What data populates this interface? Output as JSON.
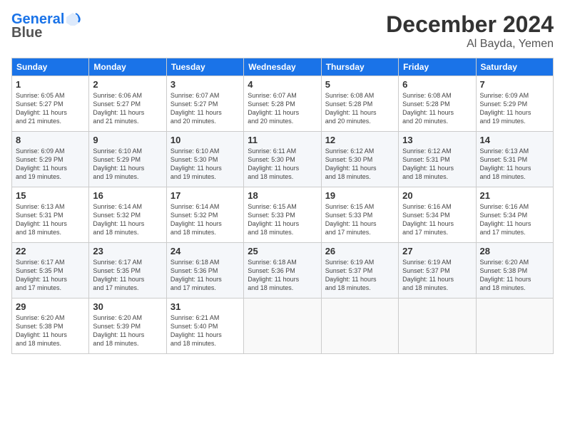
{
  "header": {
    "logo_line1": "General",
    "logo_line2": "Blue",
    "month": "December 2024",
    "location": "Al Bayda, Yemen"
  },
  "days_of_week": [
    "Sunday",
    "Monday",
    "Tuesday",
    "Wednesday",
    "Thursday",
    "Friday",
    "Saturday"
  ],
  "weeks": [
    [
      {
        "day": "1",
        "info": "Sunrise: 6:05 AM\nSunset: 5:27 PM\nDaylight: 11 hours\nand 21 minutes."
      },
      {
        "day": "2",
        "info": "Sunrise: 6:06 AM\nSunset: 5:27 PM\nDaylight: 11 hours\nand 21 minutes."
      },
      {
        "day": "3",
        "info": "Sunrise: 6:07 AM\nSunset: 5:27 PM\nDaylight: 11 hours\nand 20 minutes."
      },
      {
        "day": "4",
        "info": "Sunrise: 6:07 AM\nSunset: 5:28 PM\nDaylight: 11 hours\nand 20 minutes."
      },
      {
        "day": "5",
        "info": "Sunrise: 6:08 AM\nSunset: 5:28 PM\nDaylight: 11 hours\nand 20 minutes."
      },
      {
        "day": "6",
        "info": "Sunrise: 6:08 AM\nSunset: 5:28 PM\nDaylight: 11 hours\nand 20 minutes."
      },
      {
        "day": "7",
        "info": "Sunrise: 6:09 AM\nSunset: 5:29 PM\nDaylight: 11 hours\nand 19 minutes."
      }
    ],
    [
      {
        "day": "8",
        "info": "Sunrise: 6:09 AM\nSunset: 5:29 PM\nDaylight: 11 hours\nand 19 minutes."
      },
      {
        "day": "9",
        "info": "Sunrise: 6:10 AM\nSunset: 5:29 PM\nDaylight: 11 hours\nand 19 minutes."
      },
      {
        "day": "10",
        "info": "Sunrise: 6:10 AM\nSunset: 5:30 PM\nDaylight: 11 hours\nand 19 minutes."
      },
      {
        "day": "11",
        "info": "Sunrise: 6:11 AM\nSunset: 5:30 PM\nDaylight: 11 hours\nand 18 minutes."
      },
      {
        "day": "12",
        "info": "Sunrise: 6:12 AM\nSunset: 5:30 PM\nDaylight: 11 hours\nand 18 minutes."
      },
      {
        "day": "13",
        "info": "Sunrise: 6:12 AM\nSunset: 5:31 PM\nDaylight: 11 hours\nand 18 minutes."
      },
      {
        "day": "14",
        "info": "Sunrise: 6:13 AM\nSunset: 5:31 PM\nDaylight: 11 hours\nand 18 minutes."
      }
    ],
    [
      {
        "day": "15",
        "info": "Sunrise: 6:13 AM\nSunset: 5:31 PM\nDaylight: 11 hours\nand 18 minutes."
      },
      {
        "day": "16",
        "info": "Sunrise: 6:14 AM\nSunset: 5:32 PM\nDaylight: 11 hours\nand 18 minutes."
      },
      {
        "day": "17",
        "info": "Sunrise: 6:14 AM\nSunset: 5:32 PM\nDaylight: 11 hours\nand 18 minutes."
      },
      {
        "day": "18",
        "info": "Sunrise: 6:15 AM\nSunset: 5:33 PM\nDaylight: 11 hours\nand 18 minutes."
      },
      {
        "day": "19",
        "info": "Sunrise: 6:15 AM\nSunset: 5:33 PM\nDaylight: 11 hours\nand 17 minutes."
      },
      {
        "day": "20",
        "info": "Sunrise: 6:16 AM\nSunset: 5:34 PM\nDaylight: 11 hours\nand 17 minutes."
      },
      {
        "day": "21",
        "info": "Sunrise: 6:16 AM\nSunset: 5:34 PM\nDaylight: 11 hours\nand 17 minutes."
      }
    ],
    [
      {
        "day": "22",
        "info": "Sunrise: 6:17 AM\nSunset: 5:35 PM\nDaylight: 11 hours\nand 17 minutes."
      },
      {
        "day": "23",
        "info": "Sunrise: 6:17 AM\nSunset: 5:35 PM\nDaylight: 11 hours\nand 17 minutes."
      },
      {
        "day": "24",
        "info": "Sunrise: 6:18 AM\nSunset: 5:36 PM\nDaylight: 11 hours\nand 17 minutes."
      },
      {
        "day": "25",
        "info": "Sunrise: 6:18 AM\nSunset: 5:36 PM\nDaylight: 11 hours\nand 18 minutes."
      },
      {
        "day": "26",
        "info": "Sunrise: 6:19 AM\nSunset: 5:37 PM\nDaylight: 11 hours\nand 18 minutes."
      },
      {
        "day": "27",
        "info": "Sunrise: 6:19 AM\nSunset: 5:37 PM\nDaylight: 11 hours\nand 18 minutes."
      },
      {
        "day": "28",
        "info": "Sunrise: 6:20 AM\nSunset: 5:38 PM\nDaylight: 11 hours\nand 18 minutes."
      }
    ],
    [
      {
        "day": "29",
        "info": "Sunrise: 6:20 AM\nSunset: 5:38 PM\nDaylight: 11 hours\nand 18 minutes."
      },
      {
        "day": "30",
        "info": "Sunrise: 6:20 AM\nSunset: 5:39 PM\nDaylight: 11 hours\nand 18 minutes."
      },
      {
        "day": "31",
        "info": "Sunrise: 6:21 AM\nSunset: 5:40 PM\nDaylight: 11 hours\nand 18 minutes."
      },
      {
        "day": "",
        "info": ""
      },
      {
        "day": "",
        "info": ""
      },
      {
        "day": "",
        "info": ""
      },
      {
        "day": "",
        "info": ""
      }
    ]
  ]
}
